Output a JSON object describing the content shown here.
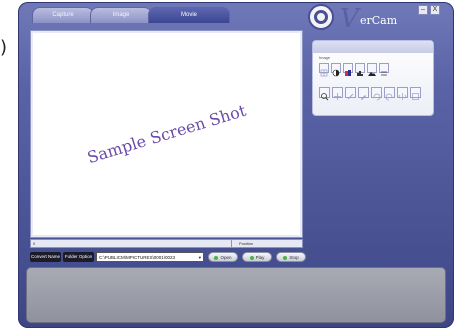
{
  "tabs": [
    {
      "label": "Capture"
    },
    {
      "label": "Image"
    },
    {
      "label": "Movie"
    }
  ],
  "brand": {
    "name_first": "V",
    "name_rest": "erCam"
  },
  "window_buttons": {
    "minimize": "–",
    "close": "X"
  },
  "viewport": {
    "watermark": "Sample Screen Shot"
  },
  "statusbar": {
    "left_value": "0",
    "position_label": "Position"
  },
  "toolbar": {
    "convert_label": "Convert Name",
    "folder_label": "Folder Option",
    "path_value": "C:\\PUBLICM\\MPICTURES\\0001\\0023",
    "path_arrow": "▾",
    "open_label": "Open",
    "play_label": "Play",
    "stop_label": "Stop"
  },
  "tool_panel": {
    "group_label": "Image",
    "row1_icons": [
      "grid-icon",
      "contrast-icon",
      "color-balance-icon",
      "histogram-icon",
      "landscape-icon",
      "levels-icon"
    ],
    "row2_icons": [
      "zoom-icon",
      "move-icon",
      "pen-icon",
      "eyedropper-icon",
      "rotate-left-icon",
      "rotate-right-icon",
      "flip-icon",
      "frame-icon"
    ]
  },
  "colors": {
    "accent": "#4d5798",
    "watermark": "#6a4aa8",
    "play_dot": "#49b34a"
  }
}
